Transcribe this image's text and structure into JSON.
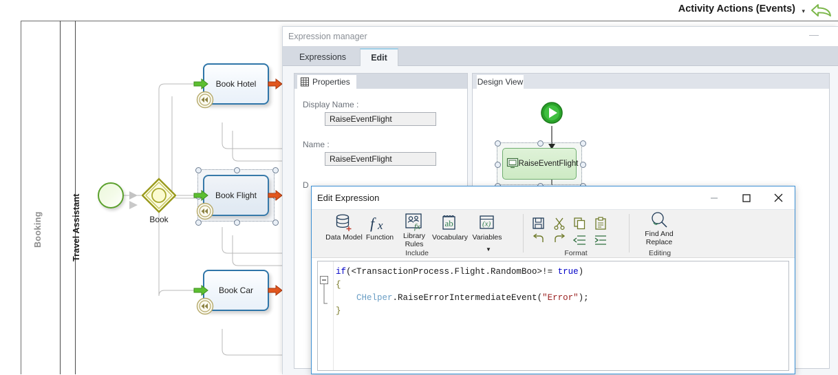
{
  "header": {
    "title": "Activity Actions (Events)",
    "caret": "▾",
    "back_icon": "back-arrow-icon"
  },
  "diagram": {
    "pool_label": "Booking",
    "lane_label": "Travel Assistant",
    "start_event": "start-event",
    "gateway": {
      "label": "Book",
      "type": "event-based-gateway"
    },
    "tasks": [
      {
        "label": "Book Hotel",
        "selected": false
      },
      {
        "label": "Book Flight",
        "selected": true
      },
      {
        "label": "Book Car",
        "selected": false
      }
    ],
    "colors": {
      "task_border": "#2e75a8",
      "start_border": "#5aa02c",
      "gateway_border": "#9a9a1e",
      "arrow_in": "#4caf28",
      "arrow_out": "#d1491a",
      "rewind_badge": "#b5a96a"
    }
  },
  "expression_manager": {
    "title": "Expression manager",
    "minimize_icon": "minimize-icon",
    "tabs": [
      {
        "label": "Expressions",
        "active": false
      },
      {
        "label": "Edit",
        "active": true
      }
    ],
    "properties": {
      "tab_label": "Properties",
      "tab_icon": "properties-grid-icon",
      "fields": [
        {
          "label": "Display Name :",
          "value": "RaiseEventFlight"
        },
        {
          "label": "Name :",
          "value": "RaiseEventFlight"
        }
      ],
      "occluded_label": "D"
    },
    "design_view": {
      "tab_label": "Design View",
      "start_node_icon": "play-circle-icon",
      "activity": {
        "label": "RaiseEventFlight",
        "icon": "screen-icon",
        "selected": true
      }
    }
  },
  "edit_expression": {
    "title": "Edit Expression",
    "window_buttons": {
      "minimize": "minimize-icon",
      "maximize": "maximize-icon",
      "close": "close-icon"
    },
    "ribbon": {
      "groups": [
        {
          "caption": "Include",
          "buttons": [
            {
              "label": "Data\nModel",
              "icon": "database-plus-icon",
              "has_caret": false
            },
            {
              "label": "Function",
              "icon": "fx-icon",
              "has_caret": false
            },
            {
              "label": "Library\nRules",
              "icon": "library-rules-icon",
              "has_caret": false
            },
            {
              "label": "Vocabulary",
              "icon": "vocabulary-ab-icon",
              "has_caret": false
            },
            {
              "label": "Variables",
              "icon": "variables-x-icon",
              "has_caret": true
            }
          ]
        },
        {
          "caption": "Format",
          "icons": [
            "save-icon",
            "cut-icon",
            "copy-icon",
            "paste-icon",
            "undo-icon",
            "redo-icon",
            "outdent-icon",
            "indent-icon"
          ]
        },
        {
          "caption": "Editing",
          "buttons": [
            {
              "label": "Find And\nReplace",
              "icon": "find-replace-icon",
              "has_caret": false
            }
          ]
        }
      ]
    },
    "editor": {
      "fold_marker": "⊟",
      "lines": [
        {
          "segments": [
            {
              "t": "if",
              "c": "keyword"
            },
            {
              "t": "(<TransactionProcess.Flight.RandomBoo>!= ",
              "c": "plain"
            },
            {
              "t": "true",
              "c": "keyword"
            },
            {
              "t": ")",
              "c": "plain"
            }
          ]
        },
        {
          "segments": [
            {
              "t": "{",
              "c": "brace"
            }
          ]
        },
        {
          "segments": [
            {
              "t": "    ",
              "c": "plain"
            },
            {
              "t": "CHelper",
              "c": "type"
            },
            {
              "t": ".RaiseErrorIntermediateEvent(",
              "c": "plain"
            },
            {
              "t": "\"Error\"",
              "c": "string"
            },
            {
              "t": ");",
              "c": "plain"
            }
          ]
        },
        {
          "segments": [
            {
              "t": "}",
              "c": "brace"
            }
          ]
        }
      ]
    }
  }
}
